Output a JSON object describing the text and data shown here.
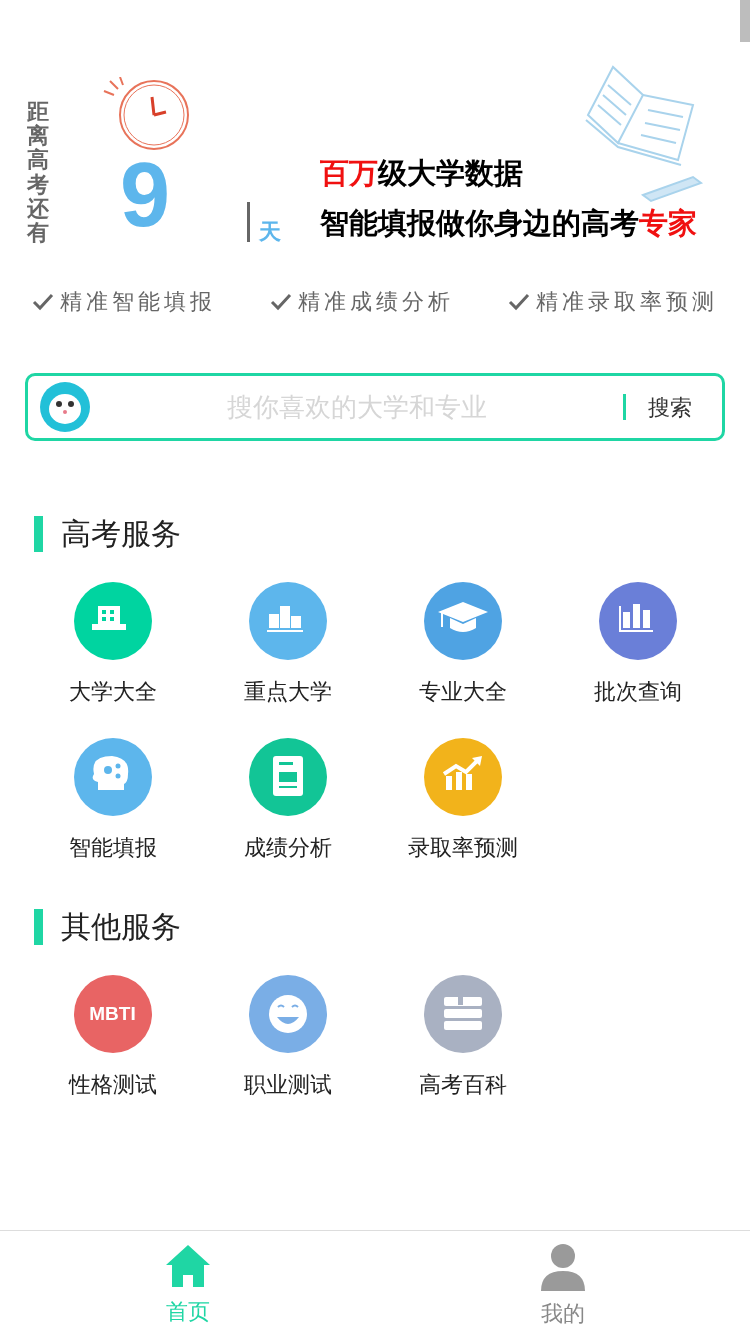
{
  "banner": {
    "countdown_label": "距离高考还有",
    "days": "9",
    "unit": "天",
    "headline": [
      [
        {
          "text": "百万",
          "highlight": true
        },
        {
          "text": "级大学数据",
          "highlight": false
        }
      ],
      [
        {
          "text": "智能填报做你身边的高考",
          "highlight": false
        },
        {
          "text": "专家",
          "highlight": true
        }
      ]
    ],
    "features": [
      "精准智能填报",
      "精准成绩分析",
      "精准录取率预测"
    ]
  },
  "search": {
    "placeholder": "搜你喜欢的大学和专业",
    "button": "搜索"
  },
  "sections": [
    {
      "title": "高考服务",
      "items": [
        {
          "label": "大学大全",
          "kind": "building",
          "color": "#00d4a0"
        },
        {
          "label": "重点大学",
          "kind": "podium",
          "color": "#5db6ec"
        },
        {
          "label": "专业大全",
          "kind": "cap",
          "color": "#4fa3e3"
        },
        {
          "label": "批次查询",
          "kind": "chart",
          "color": "#6a7fd8"
        },
        {
          "label": "智能填报",
          "kind": "head",
          "color": "#5db6ec"
        },
        {
          "label": "成绩分析",
          "kind": "score",
          "color": "#12c596"
        },
        {
          "label": "录取率预测",
          "kind": "trend",
          "color": "#f2b31b"
        }
      ]
    },
    {
      "title": "其他服务",
      "items": [
        {
          "label": "性格测试",
          "kind": "text",
          "badge_text": "MBTI",
          "color": "#e86464"
        },
        {
          "label": "职业测试",
          "kind": "smile",
          "color": "#7aaee6"
        },
        {
          "label": "高考百科",
          "kind": "books",
          "color": "#a9b1c2"
        }
      ]
    }
  ],
  "tab_bar": [
    {
      "label": "首页",
      "kind": "home",
      "selected": true
    },
    {
      "label": "我的",
      "kind": "person",
      "selected": false
    }
  ]
}
